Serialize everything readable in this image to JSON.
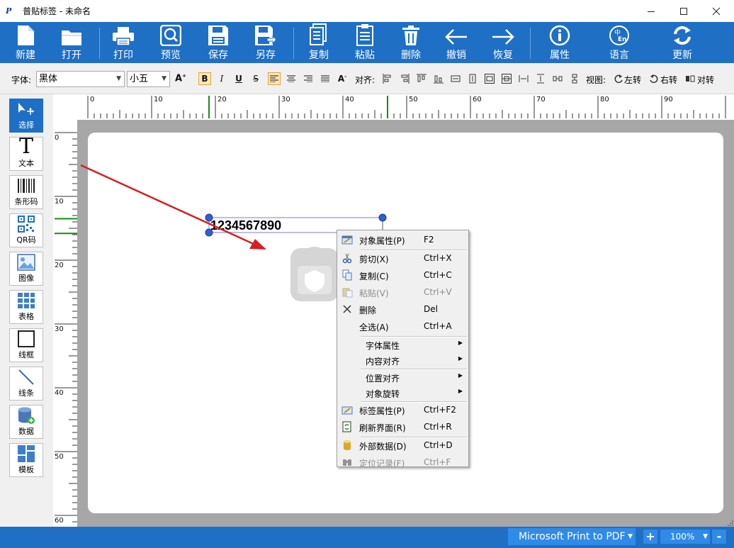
{
  "window": {
    "app_icon_text": "P",
    "title": "普贴标签 - 未命名"
  },
  "main_toolbar": [
    {
      "id": "new",
      "label": "新建",
      "icon": "new-file-icon"
    },
    {
      "id": "open",
      "label": "打开",
      "icon": "folder-icon"
    },
    {
      "id": "print",
      "label": "打印",
      "icon": "printer-icon"
    },
    {
      "id": "preview",
      "label": "预览",
      "icon": "magnifier-icon"
    },
    {
      "id": "save",
      "label": "保存",
      "icon": "floppy-icon"
    },
    {
      "id": "saveas",
      "label": "另存",
      "icon": "floppy-arrow-icon"
    },
    {
      "id": "copy",
      "label": "复制",
      "icon": "copy-icon"
    },
    {
      "id": "paste",
      "label": "粘贴",
      "icon": "paste-icon"
    },
    {
      "id": "delete",
      "label": "删除",
      "icon": "trash-icon"
    },
    {
      "id": "undo",
      "label": "撤销",
      "icon": "arrow-left-icon"
    },
    {
      "id": "redo",
      "label": "恢复",
      "icon": "arrow-right-icon"
    },
    {
      "id": "properties",
      "label": "属性",
      "icon": "info-icon"
    },
    {
      "id": "language",
      "label": "语言",
      "icon": "language-icon"
    },
    {
      "id": "update",
      "label": "更新",
      "icon": "refresh-icon"
    }
  ],
  "format_toolbar": {
    "font_label": "字体:",
    "font_value": "黑体",
    "size_value": "小五",
    "align_label": "对齐:",
    "view_label": "视图:",
    "rotate_left": "左转",
    "rotate_right": "右转",
    "flip": "对转",
    "bold": "B",
    "italic": "I",
    "underline": "U",
    "strike": "S"
  },
  "palette": [
    {
      "id": "select",
      "label": "选择",
      "icon": "select-cursor-icon",
      "active": true
    },
    {
      "id": "text",
      "label": "文本",
      "icon": "text-icon",
      "active": false
    },
    {
      "id": "barcode",
      "label": "条形码",
      "icon": "barcode-icon",
      "active": false
    },
    {
      "id": "qrcode",
      "label": "QR码",
      "icon": "qrcode-icon",
      "active": false
    },
    {
      "id": "image",
      "label": "图像",
      "icon": "image-icon",
      "active": false
    },
    {
      "id": "table",
      "label": "表格",
      "icon": "table-icon",
      "active": false
    },
    {
      "id": "frame",
      "label": "线框",
      "icon": "rectangle-icon",
      "active": false
    },
    {
      "id": "line",
      "label": "线条",
      "icon": "line-icon",
      "active": false
    },
    {
      "id": "data",
      "label": "数据",
      "icon": "database-icon",
      "active": false
    },
    {
      "id": "template",
      "label": "模板",
      "icon": "template-icon",
      "active": false
    }
  ],
  "rulers": {
    "h_labels": [
      "0",
      "10",
      "20",
      "30",
      "40",
      "50",
      "60",
      "70",
      "80",
      "90"
    ],
    "v_labels": [
      "0",
      "10",
      "20",
      "30",
      "40",
      "50",
      "60"
    ]
  },
  "canvas": {
    "text_object": "1234567890"
  },
  "context_menu": [
    {
      "type": "item",
      "label": "对象属性(P)",
      "shortcut": "F2",
      "icon": "properties-icon",
      "disabled": false
    },
    {
      "type": "sep"
    },
    {
      "type": "item",
      "label": "剪切(X)",
      "shortcut": "Ctrl+X",
      "icon": "scissors-icon",
      "disabled": false
    },
    {
      "type": "item",
      "label": "复制(C)",
      "shortcut": "Ctrl+C",
      "icon": "copy-icon",
      "disabled": false
    },
    {
      "type": "item",
      "label": "粘贴(V)",
      "shortcut": "Ctrl+V",
      "icon": "paste-icon",
      "disabled": true
    },
    {
      "type": "item",
      "label": "删除",
      "shortcut": "Del",
      "icon": "close-icon",
      "disabled": false
    },
    {
      "type": "item",
      "label": "全选(A)",
      "shortcut": "Ctrl+A",
      "icon": "",
      "disabled": false
    },
    {
      "type": "sep"
    },
    {
      "type": "sub",
      "label": "字体属性"
    },
    {
      "type": "sub",
      "label": "内容对齐"
    },
    {
      "type": "sep"
    },
    {
      "type": "sub",
      "label": "位置对齐"
    },
    {
      "type": "sub",
      "label": "对象旋转"
    },
    {
      "type": "sep"
    },
    {
      "type": "item",
      "label": "标签属性(P)",
      "shortcut": "Ctrl+F2",
      "icon": "label-properties-icon",
      "disabled": false
    },
    {
      "type": "item",
      "label": "刷新界面(R)",
      "shortcut": "Ctrl+R",
      "icon": "refresh-icon",
      "disabled": false
    },
    {
      "type": "sep"
    },
    {
      "type": "item",
      "label": "外部数据(D)",
      "shortcut": "Ctrl+D",
      "icon": "database-icon",
      "disabled": false
    },
    {
      "type": "item",
      "label": "定位记录(F)",
      "shortcut": "Ctrl+F",
      "icon": "binoculars-icon",
      "disabled": true
    }
  ],
  "status_bar": {
    "printer": "Microsoft Print to PDF",
    "zoom": "100%",
    "zoom_in": "+",
    "zoom_out": "-"
  },
  "colors": {
    "toolbar_blue": "#1f6fc4",
    "annotation_red": "#d42020"
  }
}
